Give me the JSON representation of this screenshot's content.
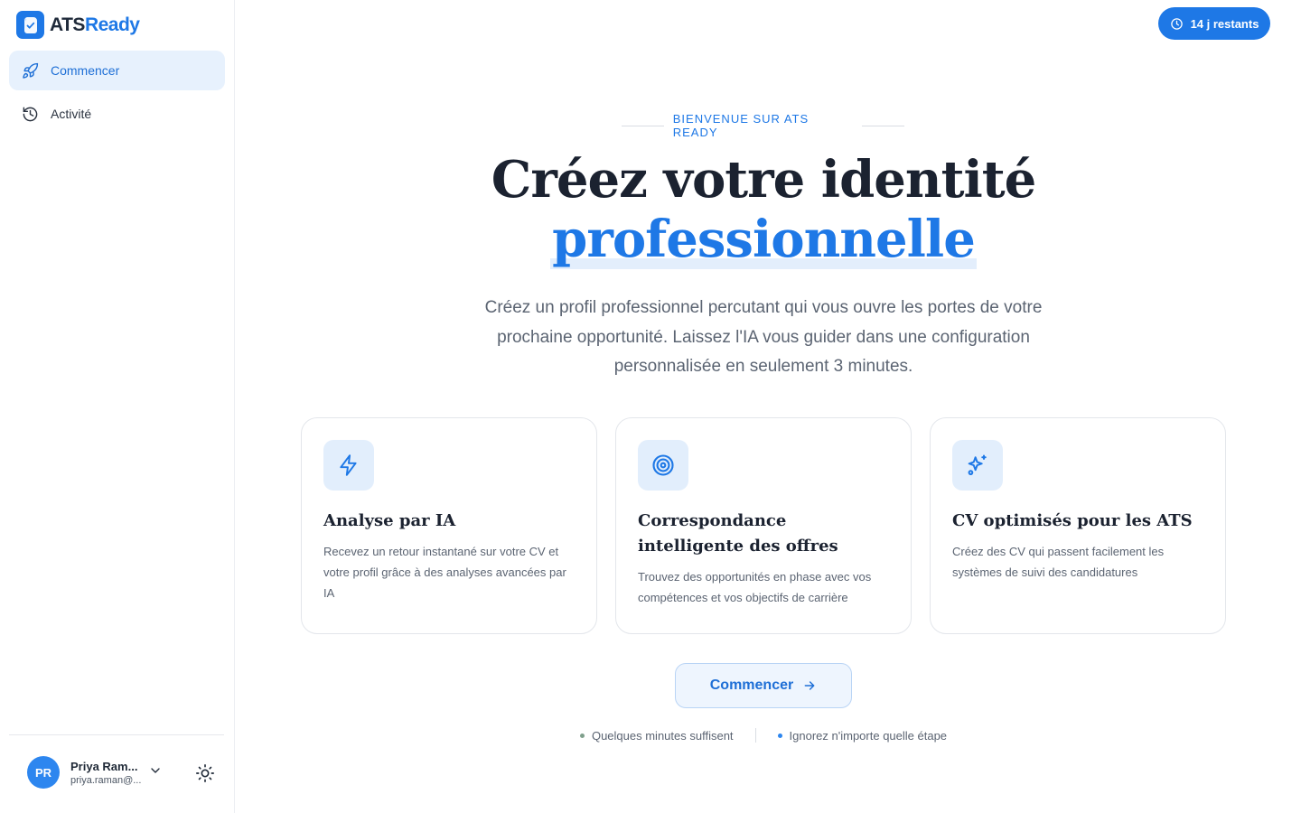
{
  "brand": {
    "name_prefix": "ATS",
    "name_suffix": "Ready"
  },
  "sidebar": {
    "items": [
      {
        "label": "Commencer",
        "icon": "rocket-icon",
        "active": true
      },
      {
        "label": "Activité",
        "icon": "history-icon",
        "active": false
      }
    ],
    "user": {
      "initials": "PR",
      "name": "Priya Ram...",
      "email": "priya.raman@..."
    }
  },
  "trial": {
    "label": "14 j restants",
    "icon": "clock-icon"
  },
  "hero": {
    "eyebrow": "BIENVENUE SUR ATS READY",
    "title_line1": "Créez votre identité",
    "title_line2": "professionnelle",
    "subtitle": "Créez un profil professionnel percutant qui vous ouvre les portes de votre prochaine opportunité. Laissez l'IA vous guider dans une configuration personnalisée en seulement 3 minutes."
  },
  "features": [
    {
      "icon": "lightning-icon",
      "title": "Analyse par IA",
      "description": "Recevez un retour instantané sur votre CV et votre profil grâce à des analyses avancées par IA"
    },
    {
      "icon": "target-icon",
      "title": "Correspondance intelligente des offres",
      "description": "Trouvez des opportunités en phase avec vos compétences et vos objectifs de carrière"
    },
    {
      "icon": "sparkles-icon",
      "title": "CV optimisés pour les ATS",
      "description": "Créez des CV qui passent facilement les systèmes de suivi des candidatures"
    }
  ],
  "cta": {
    "label": "Commencer"
  },
  "hints": [
    {
      "label": "Quelques minutes suffisent",
      "dot_color": "#7fa08c"
    },
    {
      "label": "Ignorez n'importe quelle étape",
      "dot_color": "#2d86ef"
    }
  ],
  "colors": {
    "accent": "#1e78e6",
    "accent_light": "#e2eefc",
    "text_dark": "#1b2230",
    "text_muted": "#5b6472"
  }
}
